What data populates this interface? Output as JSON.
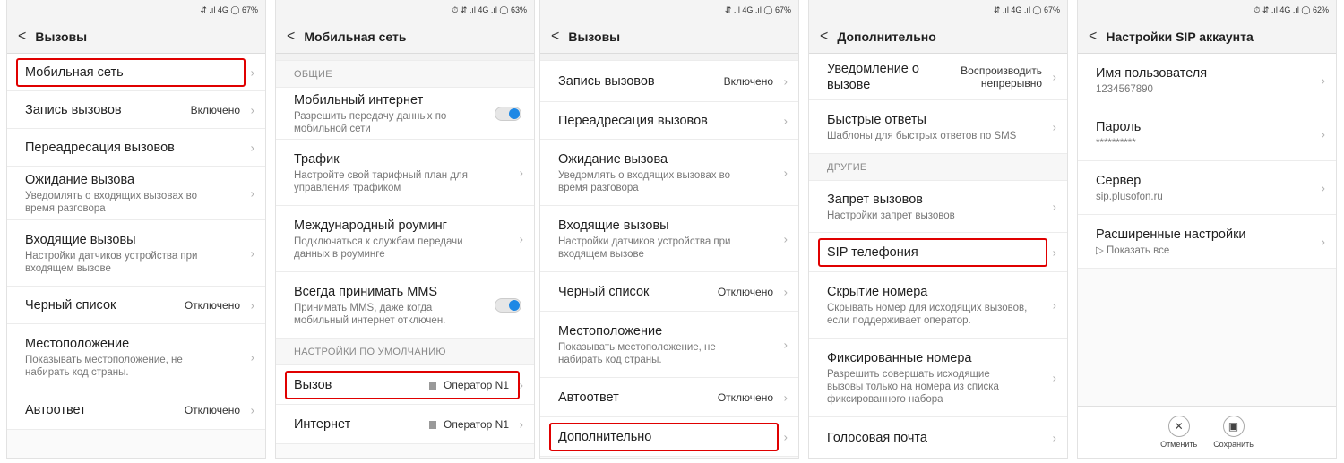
{
  "status": {
    "s1": "⇵ .ıl 4G ◯ 67%",
    "s2": "⏱ ⇵ .ıl 4G .ıl ◯ 63%",
    "s3": "⇵ .ıl 4G .ıl ◯ 67%",
    "s4": "⇵ .ıl 4G .ıl ◯ 67%",
    "s5": "⏱ ⇵ .ıl 4G .ıl ◯ 62%"
  },
  "screen1": {
    "title": "Вызовы",
    "items": [
      {
        "title": "Мобильная сеть"
      },
      {
        "title": "Запись вызовов",
        "value": "Включено"
      },
      {
        "title": "Переадресация вызовов"
      },
      {
        "title": "Ожидание вызова",
        "sub": "Уведомлять о входящих вызовах во время разговора"
      },
      {
        "title": "Входящие вызовы",
        "sub": "Настройки датчиков устройства при входящем вызове"
      },
      {
        "title": "Черный список",
        "value": "Отключено"
      },
      {
        "title": "Местоположение",
        "sub": "Показывать местоположение, не набирать код страны."
      },
      {
        "title": "Автоответ",
        "value": "Отключено"
      }
    ]
  },
  "screen2": {
    "title": "Мобильная сеть",
    "section_general": "ОБЩИЕ",
    "section_default": "НАСТРОЙКИ ПО УМОЛЧАНИЮ",
    "items": [
      {
        "title": "Мобильный интернет",
        "sub": "Разрешить передачу данных по мобильной сети"
      },
      {
        "title": "Трафик",
        "sub": "Настройте свой тарифный план для управления трафиком"
      },
      {
        "title": "Международный роуминг",
        "sub": "Подключаться к службам передачи данных в роуминге"
      },
      {
        "title": "Всегда принимать MMS",
        "sub": "Принимать MMS, даже когда мобильный интернет отключен."
      },
      {
        "title": "Вызов",
        "value": "Оператор N1"
      },
      {
        "title": "Интернет",
        "value": "Оператор N1"
      }
    ]
  },
  "screen3": {
    "title": "Вызовы",
    "items": [
      {
        "title": "Запись вызовов",
        "value": "Включено"
      },
      {
        "title": "Переадресация вызовов"
      },
      {
        "title": "Ожидание вызова",
        "sub": "Уведомлять о входящих вызовах во время разговора"
      },
      {
        "title": "Входящие вызовы",
        "sub": "Настройки датчиков устройства при входящем вызове"
      },
      {
        "title": "Черный список",
        "value": "Отключено"
      },
      {
        "title": "Местоположение",
        "sub": "Показывать местоположение, не набирать код страны."
      },
      {
        "title": "Автоответ",
        "value": "Отключено"
      },
      {
        "title": "Дополнительно"
      }
    ]
  },
  "screen4": {
    "title": "Дополнительно",
    "section_other": "ДРУГИЕ",
    "items": [
      {
        "title": "Уведомление о вызове",
        "value": "Воспроизводить непрерывно"
      },
      {
        "title": "Быстрые ответы",
        "sub": "Шаблоны для быстрых ответов по SMS"
      },
      {
        "title": "Запрет вызовов",
        "sub": "Настройки запрет вызовов"
      },
      {
        "title": "SIP телефония"
      },
      {
        "title": "Скрытие номера",
        "sub": "Скрывать номер для исходящих вызовов, если поддерживает оператор."
      },
      {
        "title": "Фиксированные номера",
        "sub": "Разрешить совершать исходящие вызовы только на номера из списка фиксированного набора"
      },
      {
        "title": "Голосовая почта"
      }
    ]
  },
  "screen5": {
    "title": "Настройки SIP аккаунта",
    "items": [
      {
        "title": "Имя пользователя",
        "sub": "1234567890"
      },
      {
        "title": "Пароль",
        "sub": "**********"
      },
      {
        "title": "Сервер",
        "sub": "sip.plusofon.ru"
      },
      {
        "title": "Расширенные настройки",
        "sub": "▷ Показать все"
      }
    ],
    "cancel_label": "Отменить",
    "save_label": "Сохранить"
  }
}
